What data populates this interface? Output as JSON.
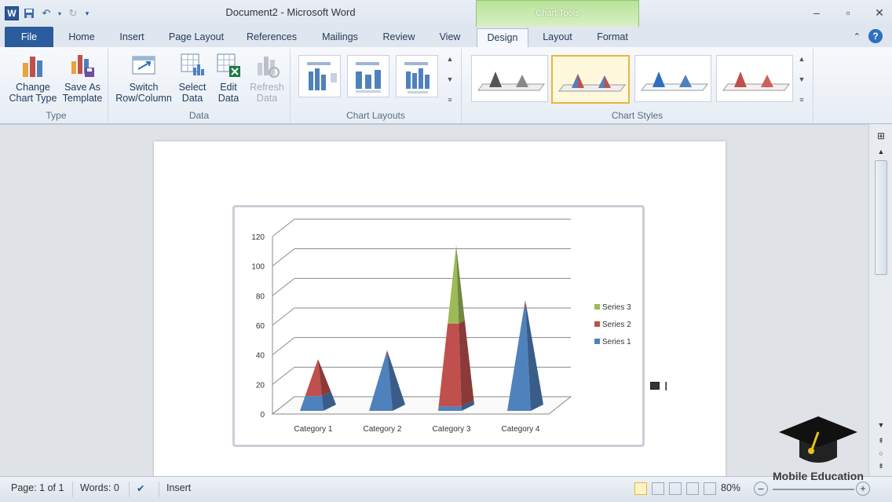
{
  "window": {
    "title": "Document2 - Microsoft Word",
    "context_tab_title": "Chart Tools"
  },
  "tabs": {
    "file": "File",
    "home": "Home",
    "insert": "Insert",
    "page_layout": "Page Layout",
    "references": "References",
    "mailings": "Mailings",
    "review": "Review",
    "view": "View",
    "design": "Design",
    "layout": "Layout",
    "format": "Format"
  },
  "ribbon": {
    "type_group": {
      "label": "Type",
      "change_chart_type": [
        "Change",
        "Chart Type"
      ],
      "save_as_template": [
        "Save As",
        "Template"
      ]
    },
    "data_group": {
      "label": "Data",
      "switch_row_column": [
        "Switch",
        "Row/Column"
      ],
      "select_data": [
        "Select",
        "Data"
      ],
      "edit_data": [
        "Edit",
        "Data"
      ],
      "refresh_data": [
        "Refresh",
        "Data"
      ]
    },
    "chart_layouts_label": "Chart Layouts",
    "chart_styles_label": "Chart Styles"
  },
  "chart_data": {
    "type": "bar",
    "subtype": "3d-stacked-pyramid",
    "categories": [
      "Category 1",
      "Category 2",
      "Category 3",
      "Category 4"
    ],
    "series": [
      {
        "name": "Series 1",
        "color": "#4f81bd",
        "values": [
          10,
          38,
          3,
          70
        ]
      },
      {
        "name": "Series 2",
        "color": "#c0504d",
        "values": [
          25,
          3,
          56,
          5
        ]
      },
      {
        "name": "Series 3",
        "color": "#9bbb59",
        "values": [
          0,
          0,
          53,
          0
        ]
      }
    ],
    "yticks": [
      "0",
      "20",
      "40",
      "60",
      "80",
      "100",
      "120"
    ],
    "ylim": [
      0,
      120
    ],
    "legend_position": "right",
    "grid": true
  },
  "status": {
    "page": "Page: 1 of 1",
    "words": "Words: 0",
    "mode": "Insert",
    "zoom": "80%"
  },
  "watermark": "Mobile Education",
  "colors": {
    "file_tab": "#2a5c9e",
    "context_tab": "#b9e39a",
    "selected_style_border": "#e6b83a"
  }
}
